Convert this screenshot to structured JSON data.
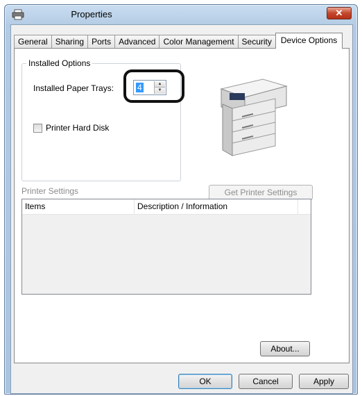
{
  "window": {
    "title": "Properties"
  },
  "tabs": [
    {
      "label": "General"
    },
    {
      "label": "Sharing"
    },
    {
      "label": "Ports"
    },
    {
      "label": "Advanced"
    },
    {
      "label": "Color Management"
    },
    {
      "label": "Security"
    },
    {
      "label": "Device Options",
      "active": true
    }
  ],
  "installed_options": {
    "group_label": "Installed Options",
    "paper_trays_label": "Installed Paper Trays:",
    "paper_trays_value": "4",
    "hard_disk_label": "Printer Hard Disk",
    "hard_disk_checked": false
  },
  "printer_settings": {
    "section_label": "Printer Settings",
    "get_settings_button": "Get Printer Settings",
    "columns": [
      "Items",
      "Description / Information"
    ],
    "rows": []
  },
  "buttons": {
    "about": "About...",
    "ok": "OK",
    "cancel": "Cancel",
    "apply": "Apply"
  },
  "icons": {
    "title_icon": "printer-icon",
    "close": "close-icon",
    "spin_up": "spin-up-icon",
    "spin_down": "spin-down-icon"
  },
  "colors": {
    "selection": "#3399ff",
    "close_button": "#c4472b",
    "annotation_ring": "#111111"
  }
}
